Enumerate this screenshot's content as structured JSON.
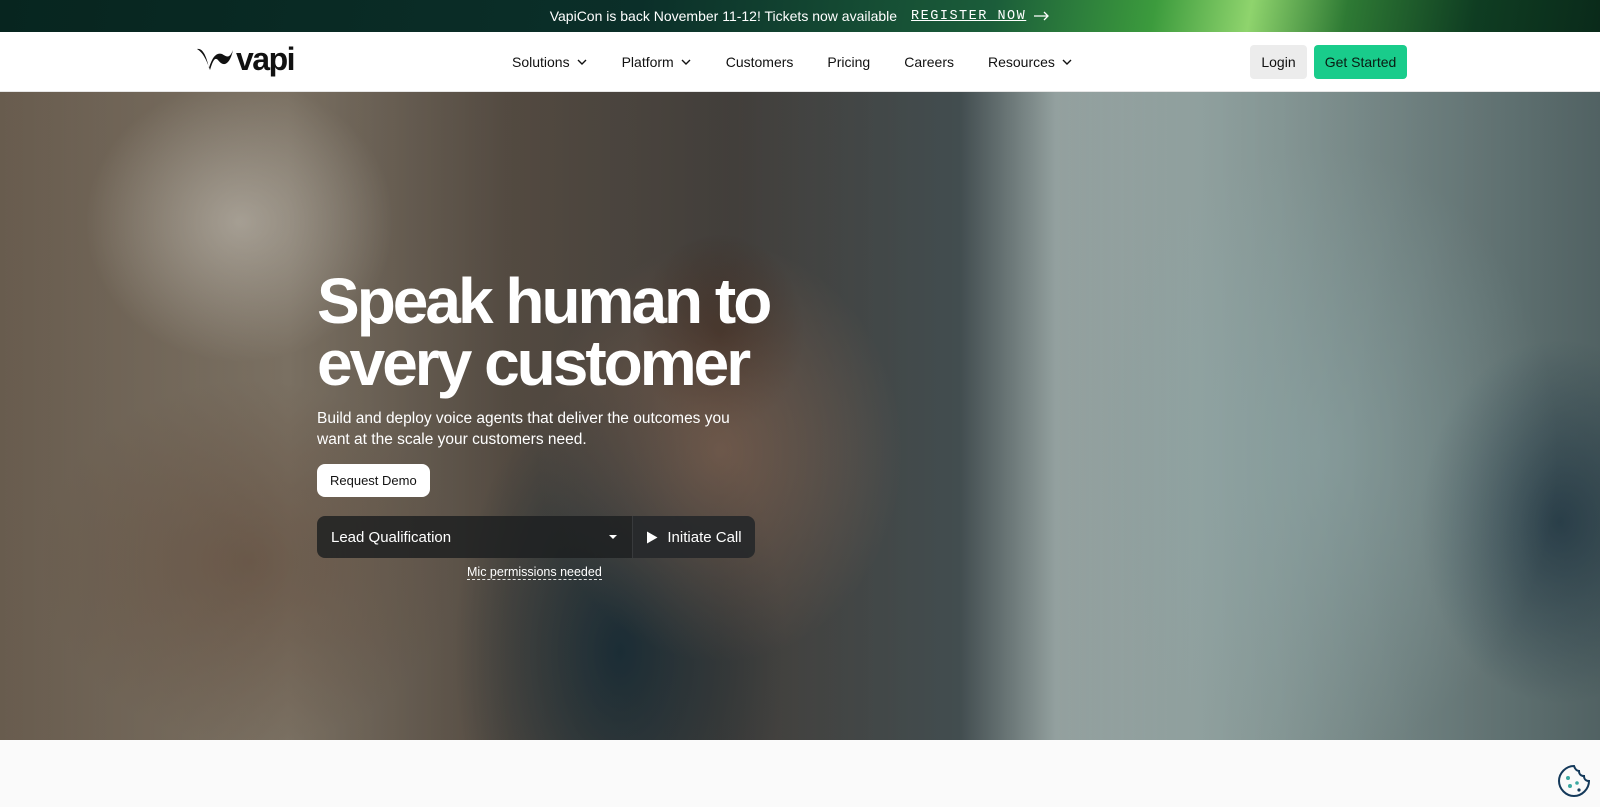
{
  "announcement": {
    "text": "VapiCon is back November 11-12! Tickets now available",
    "cta": "REGISTER NOW",
    "arrow_icon": "arrow-right-icon"
  },
  "nav": {
    "logo_text": "vapi",
    "items": [
      {
        "label": "Solutions",
        "has_dropdown": true
      },
      {
        "label": "Platform",
        "has_dropdown": true
      },
      {
        "label": "Customers",
        "has_dropdown": false
      },
      {
        "label": "Pricing",
        "has_dropdown": false
      },
      {
        "label": "Careers",
        "has_dropdown": false
      },
      {
        "label": "Resources",
        "has_dropdown": true
      }
    ],
    "login": "Login",
    "get_started": "Get Started"
  },
  "hero": {
    "headline_line1": "Speak human to",
    "headline_line2": "every customer",
    "subhead": "Build and deploy voice agents that deliver the outcomes you want at the scale your customers need.",
    "demo_button": "Request Demo",
    "select_value": "Lead Qualification",
    "call_button": "Initiate Call",
    "mic_note": "Mic permissions needed"
  },
  "colors": {
    "accent": "#19cc8b",
    "announcement_bg": "#0b2f29"
  }
}
